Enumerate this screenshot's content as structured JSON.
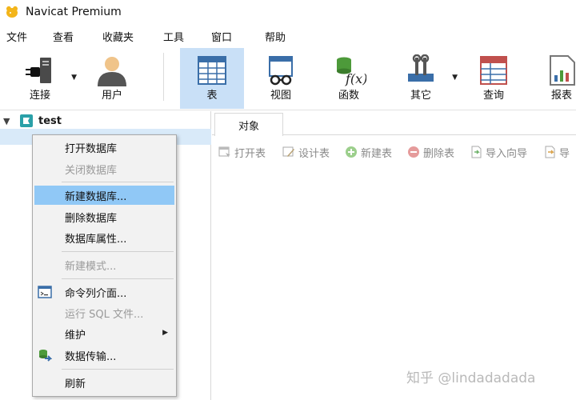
{
  "window": {
    "title": "Navicat Premium"
  },
  "menu": [
    "文件",
    "查看",
    "收藏夹",
    "工具",
    "窗口",
    "帮助"
  ],
  "toolbar": {
    "connect": "连接",
    "user": "用户",
    "table": "表",
    "view": "视图",
    "function": "函数",
    "other": "其它",
    "query": "查询",
    "report": "报表"
  },
  "tree": {
    "root_label": "test"
  },
  "tabs": {
    "objects": "对象"
  },
  "object_toolbar": {
    "open_table": "打开表",
    "design_table": "设计表",
    "new_table": "新建表",
    "delete_table": "删除表",
    "import_wizard": "导入向导",
    "export_wizard": "导"
  },
  "context_menu": {
    "open_db": "打开数据库",
    "close_db": "关闭数据库",
    "new_db": "新建数据库...",
    "delete_db": "删除数据库",
    "db_props": "数据库属性...",
    "new_schema": "新建模式...",
    "console": "命令列介面...",
    "run_sql": "运行 SQL 文件...",
    "maintain": "维护",
    "transfer": "数据传输...",
    "refresh": "刷新"
  },
  "watermark": "知乎 @lindadadada",
  "colors": {
    "accent": "#90c8f6",
    "toolbar_active": "#c9e0f7",
    "disabled": "#9a9a9a"
  }
}
